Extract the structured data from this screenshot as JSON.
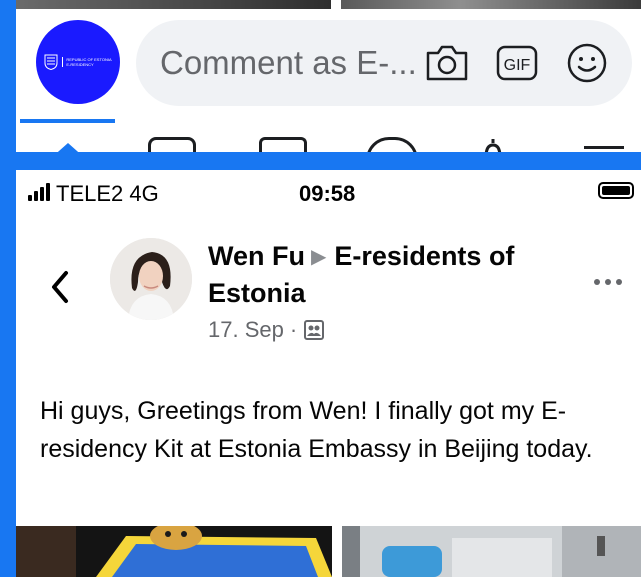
{
  "comment_bar": {
    "page_avatar_label_1": "REPUBLIC OF ESTONIA",
    "page_avatar_label_2": "E-RESIDENCY",
    "placeholder": "Comment as E-...",
    "camera_icon": "camera-icon",
    "gif_label": "GIF",
    "emoji_icon": "smiley-icon"
  },
  "status_bar": {
    "carrier": "TELE2  4G",
    "time": "09:58"
  },
  "post": {
    "author": "Wen Fu",
    "group": "E-residents of Estonia",
    "date": "17. Sep",
    "separator": "·",
    "audience_icon": "group-members-icon",
    "body": "Hi guys, Greetings from Wen! I finally got my E-residency Kit at Estonia Embassy in Beijing today."
  },
  "colors": {
    "brand_blue": "#1877f2",
    "estonia_blue": "#1a1aff",
    "input_bg": "#f0f2f5",
    "secondary_text": "#65676b"
  }
}
